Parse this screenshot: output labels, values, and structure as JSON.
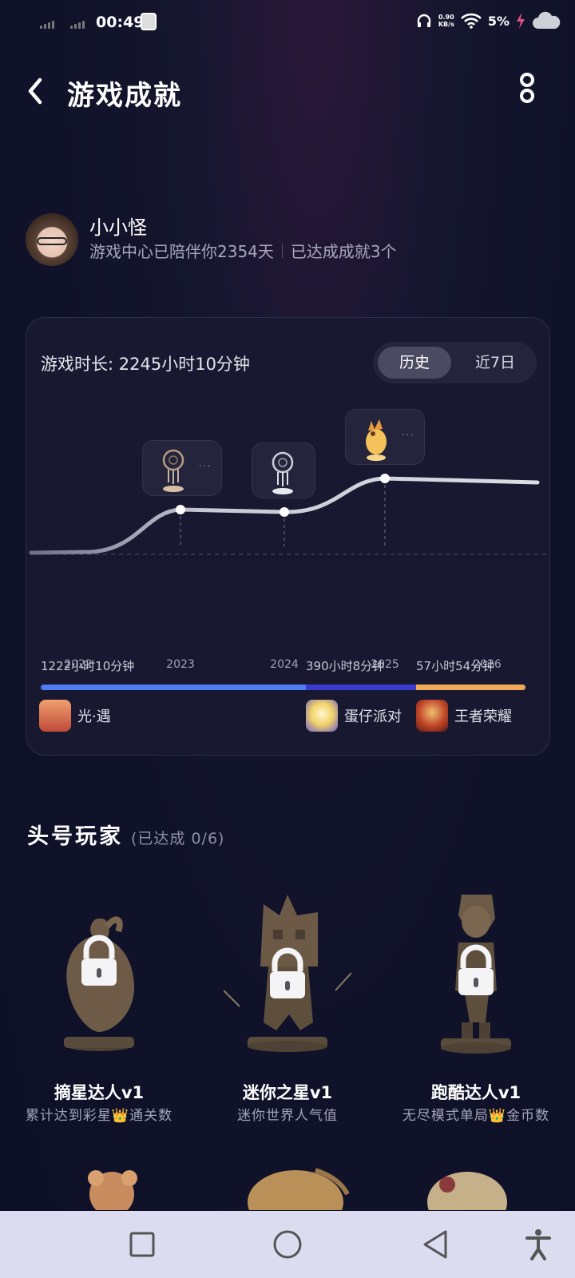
{
  "status_bar": {
    "time": "00:49",
    "net_speed_value": "0.90",
    "net_speed_unit": "KB/s",
    "battery": "5%"
  },
  "header": {
    "title": "游戏成就"
  },
  "profile": {
    "name": "小小怪",
    "days_text": "游戏中心已陪伴你2354天",
    "achieved_text": "已达成成就3个"
  },
  "card": {
    "playtime_label": "游戏时长: ",
    "playtime_value": "2245小时10分钟",
    "tabs": [
      {
        "label": "历史",
        "active": true
      },
      {
        "label": "近7日",
        "active": false
      }
    ],
    "years": [
      "2022",
      "2023",
      "2024",
      "2025",
      "2026"
    ],
    "games": [
      {
        "duration": "1222小时10分钟",
        "name": "光·遇",
        "color": "#4f7cf0",
        "share": 0.5443
      },
      {
        "duration": "390小时8分钟",
        "name": "蛋仔派对",
        "color": "#3b3bd0",
        "share": 0.1738
      },
      {
        "duration": "57小时54分钟",
        "name": "王者荣耀",
        "color": "#f0a95a",
        "share": 0.0258
      }
    ]
  },
  "section": {
    "title": "头号玩家",
    "subtitle": "(已达成 0/6)"
  },
  "achievements": [
    {
      "name": "摘星达人v1",
      "desc": "累计达到彩星👑通关数"
    },
    {
      "name": "迷你之星v1",
      "desc": "迷你世界人气值"
    },
    {
      "name": "跑酷达人v1",
      "desc": "无尽模式单局👑金币数"
    }
  ],
  "colors": {
    "accent_blue": "#4f7cf0",
    "accent_indigo": "#3b3bd0",
    "accent_orange": "#f0a95a",
    "nav_bg": "#dcdcf0"
  }
}
